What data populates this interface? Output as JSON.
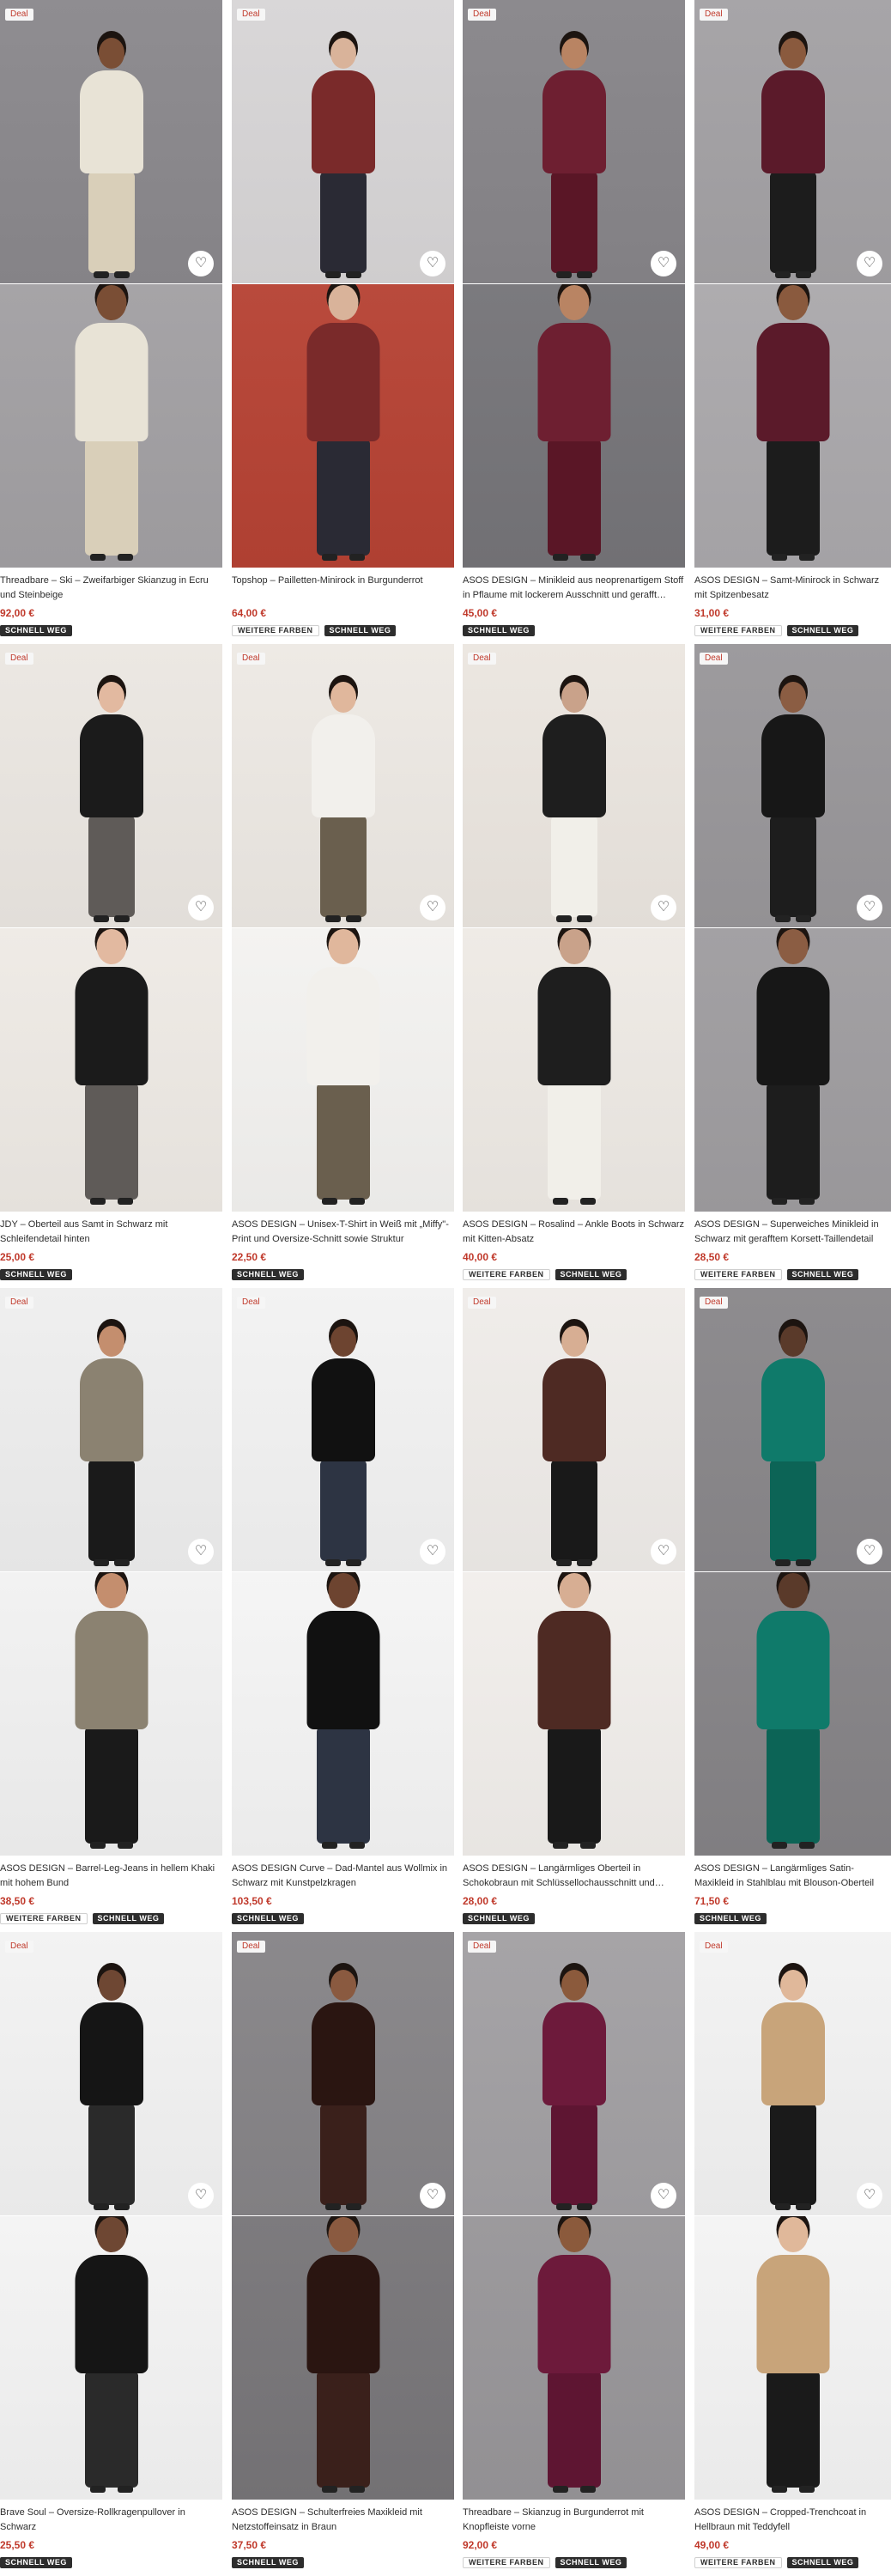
{
  "labels": {
    "deal": "Deal",
    "more_colours": "WEITERE FARBEN",
    "sell_out": "SCHNELL WEG"
  },
  "products": [
    {
      "title": "Threadbare – Ski – Zweifarbiger Skianzug in Ecru und Steinbeige",
      "price": "92,00 €",
      "deal": true,
      "more_colours": false,
      "sell_out": true,
      "colors": {
        "bg1": "#8f8d91",
        "bg2": "#a6a4a7",
        "garment": "#e8e3d6",
        "garment2": "#d9cfb9",
        "skin": "#7a4e35"
      }
    },
    {
      "title": "Topshop – Pailletten-Minirock in Burgunderrot",
      "price": "64,00 €",
      "deal": true,
      "more_colours": true,
      "sell_out": true,
      "colors": {
        "bg1": "#d9d7d8",
        "bg2": "#b94a3c",
        "garment": "#7a2a2a",
        "garment2": "#2a2a34",
        "skin": "#d9b39a"
      }
    },
    {
      "title": "ASOS DESIGN – Minikleid aus neoprenartigem Stoff in Pflaume mit lockerem Ausschnitt und gerafft…",
      "price": "45,00 €",
      "deal": true,
      "more_colours": false,
      "sell_out": true,
      "colors": {
        "bg1": "#8c8a8e",
        "bg2": "#7b7a7e",
        "garment": "#6e1f31",
        "garment2": "#5a1626",
        "skin": "#b98463"
      }
    },
    {
      "title": "ASOS DESIGN – Samt-Minirock in Schwarz mit Spitzenbesatz",
      "price": "31,00 €",
      "deal": true,
      "more_colours": true,
      "sell_out": true,
      "colors": {
        "bg1": "#a7a5a8",
        "bg2": "#aeacaf",
        "garment": "#5b1a2a",
        "garment2": "#1c1c1c",
        "skin": "#8a5a3e"
      }
    },
    {
      "title": "JDY – Oberteil aus Samt in Schwarz mit Schleifendetail hinten",
      "price": "25,00 €",
      "deal": true,
      "more_colours": false,
      "sell_out": true,
      "colors": {
        "bg1": "#ece8e3",
        "bg2": "#efebe6",
        "garment": "#1b1b1b",
        "garment2": "#5f5b58",
        "skin": "#e2b9a0"
      }
    },
    {
      "title": "ASOS DESIGN – Unisex-T-Shirt in Weiß mit „Miffy\"-Print und Oversize-Schnitt sowie Struktur",
      "price": "22,50 €",
      "deal": true,
      "more_colours": false,
      "sell_out": true,
      "colors": {
        "bg1": "#eeeae5",
        "bg2": "#f4f3f1",
        "garment": "#f2f0ec",
        "garment2": "#6a5f4e",
        "skin": "#e0b79c"
      }
    },
    {
      "title": "ASOS DESIGN – Rosalind – Ankle Boots in Schwarz mit Kitten-Absatz",
      "price": "40,00 €",
      "deal": true,
      "more_colours": true,
      "sell_out": true,
      "colors": {
        "bg1": "#ece7e1",
        "bg2": "#efebe6",
        "garment": "#1e1e1e",
        "garment2": "#f1efe9",
        "skin": "#c9a28a"
      }
    },
    {
      "title": "ASOS DESIGN – Superweiches Minikleid in Schwarz mit gerafftem Korsett-Taillendetail",
      "price": "28,50 €",
      "deal": true,
      "more_colours": true,
      "sell_out": true,
      "colors": {
        "bg1": "#9d9b9e",
        "bg2": "#a3a1a4",
        "garment": "#171717",
        "garment2": "#1d1d1d",
        "skin": "#8b5d43"
      }
    },
    {
      "title": "ASOS DESIGN – Barrel-Leg-Jeans in hellem Khaki mit hohem Bund",
      "price": "38,50 €",
      "deal": true,
      "more_colours": true,
      "sell_out": true,
      "colors": {
        "bg1": "#efefef",
        "bg2": "#f2f2f2",
        "garment": "#8b8271",
        "garment2": "#1a1a1a",
        "skin": "#c48e6e"
      }
    },
    {
      "title": "ASOS DESIGN Curve – Dad-Mantel aus Wollmix in Schwarz mit Kunstpelzkragen",
      "price": "103,50 €",
      "deal": true,
      "more_colours": false,
      "sell_out": true,
      "colors": {
        "bg1": "#f3f3f3",
        "bg2": "#f5f5f5",
        "garment": "#111111",
        "garment2": "#2d3443",
        "skin": "#6d4430"
      }
    },
    {
      "title": "ASOS DESIGN – Langärmliges Oberteil in Schokobraun mit Schlüssellochausschnitt und…",
      "price": "28,00 €",
      "deal": true,
      "more_colours": false,
      "sell_out": true,
      "colors": {
        "bg1": "#f0edea",
        "bg2": "#f2efec",
        "garment": "#4e2a23",
        "garment2": "#191919",
        "skin": "#d7ae93"
      }
    },
    {
      "title": "ASOS DESIGN – Langärmliges Satin-Maxikleid in Stahlblau mit Blouson-Oberteil",
      "price": "71,50 €",
      "deal": true,
      "more_colours": false,
      "sell_out": true,
      "colors": {
        "bg1": "#8e8c8f",
        "bg2": "#8a888b",
        "garment": "#0f7a6a",
        "garment2": "#0c6456",
        "skin": "#5a3a2a"
      }
    },
    {
      "title": "Brave Soul – Oversize-Rollkragenpullover in Schwarz",
      "price": "25,50 €",
      "deal": true,
      "more_colours": false,
      "sell_out": true,
      "colors": {
        "bg1": "#f3f3f3",
        "bg2": "#f4f4f4",
        "garment": "#151515",
        "garment2": "#2a2a2a",
        "skin": "#6e4733"
      }
    },
    {
      "title": "ASOS DESIGN – Schulterfreies Maxikleid mit Netzstoffeinsatz in Braun",
      "price": "37,50 €",
      "deal": true,
      "more_colours": false,
      "sell_out": true,
      "colors": {
        "bg1": "#8b898c",
        "bg2": "#7d7b7e",
        "garment": "#2a1511",
        "garment2": "#3a201b",
        "skin": "#8a5a40"
      }
    },
    {
      "title": "Threadbare – Skianzug in Burgunderrot mit Knopfleiste vorne",
      "price": "92,00 €",
      "deal": true,
      "more_colours": true,
      "sell_out": true,
      "colors": {
        "bg1": "#a6a4a7",
        "bg2": "#9c9a9d",
        "garment": "#6d1a3b",
        "garment2": "#5e1532",
        "skin": "#8b5a3c"
      }
    },
    {
      "title": "ASOS DESIGN – Cropped-Trenchcoat in Hellbraun mit Teddyfell",
      "price": "49,00 €",
      "deal": true,
      "more_colours": true,
      "sell_out": true,
      "colors": {
        "bg1": "#f3f3f3",
        "bg2": "#f4f4f4",
        "garment": "#c8a47a",
        "garment2": "#1a1a1a",
        "skin": "#e0b89a"
      }
    }
  ]
}
